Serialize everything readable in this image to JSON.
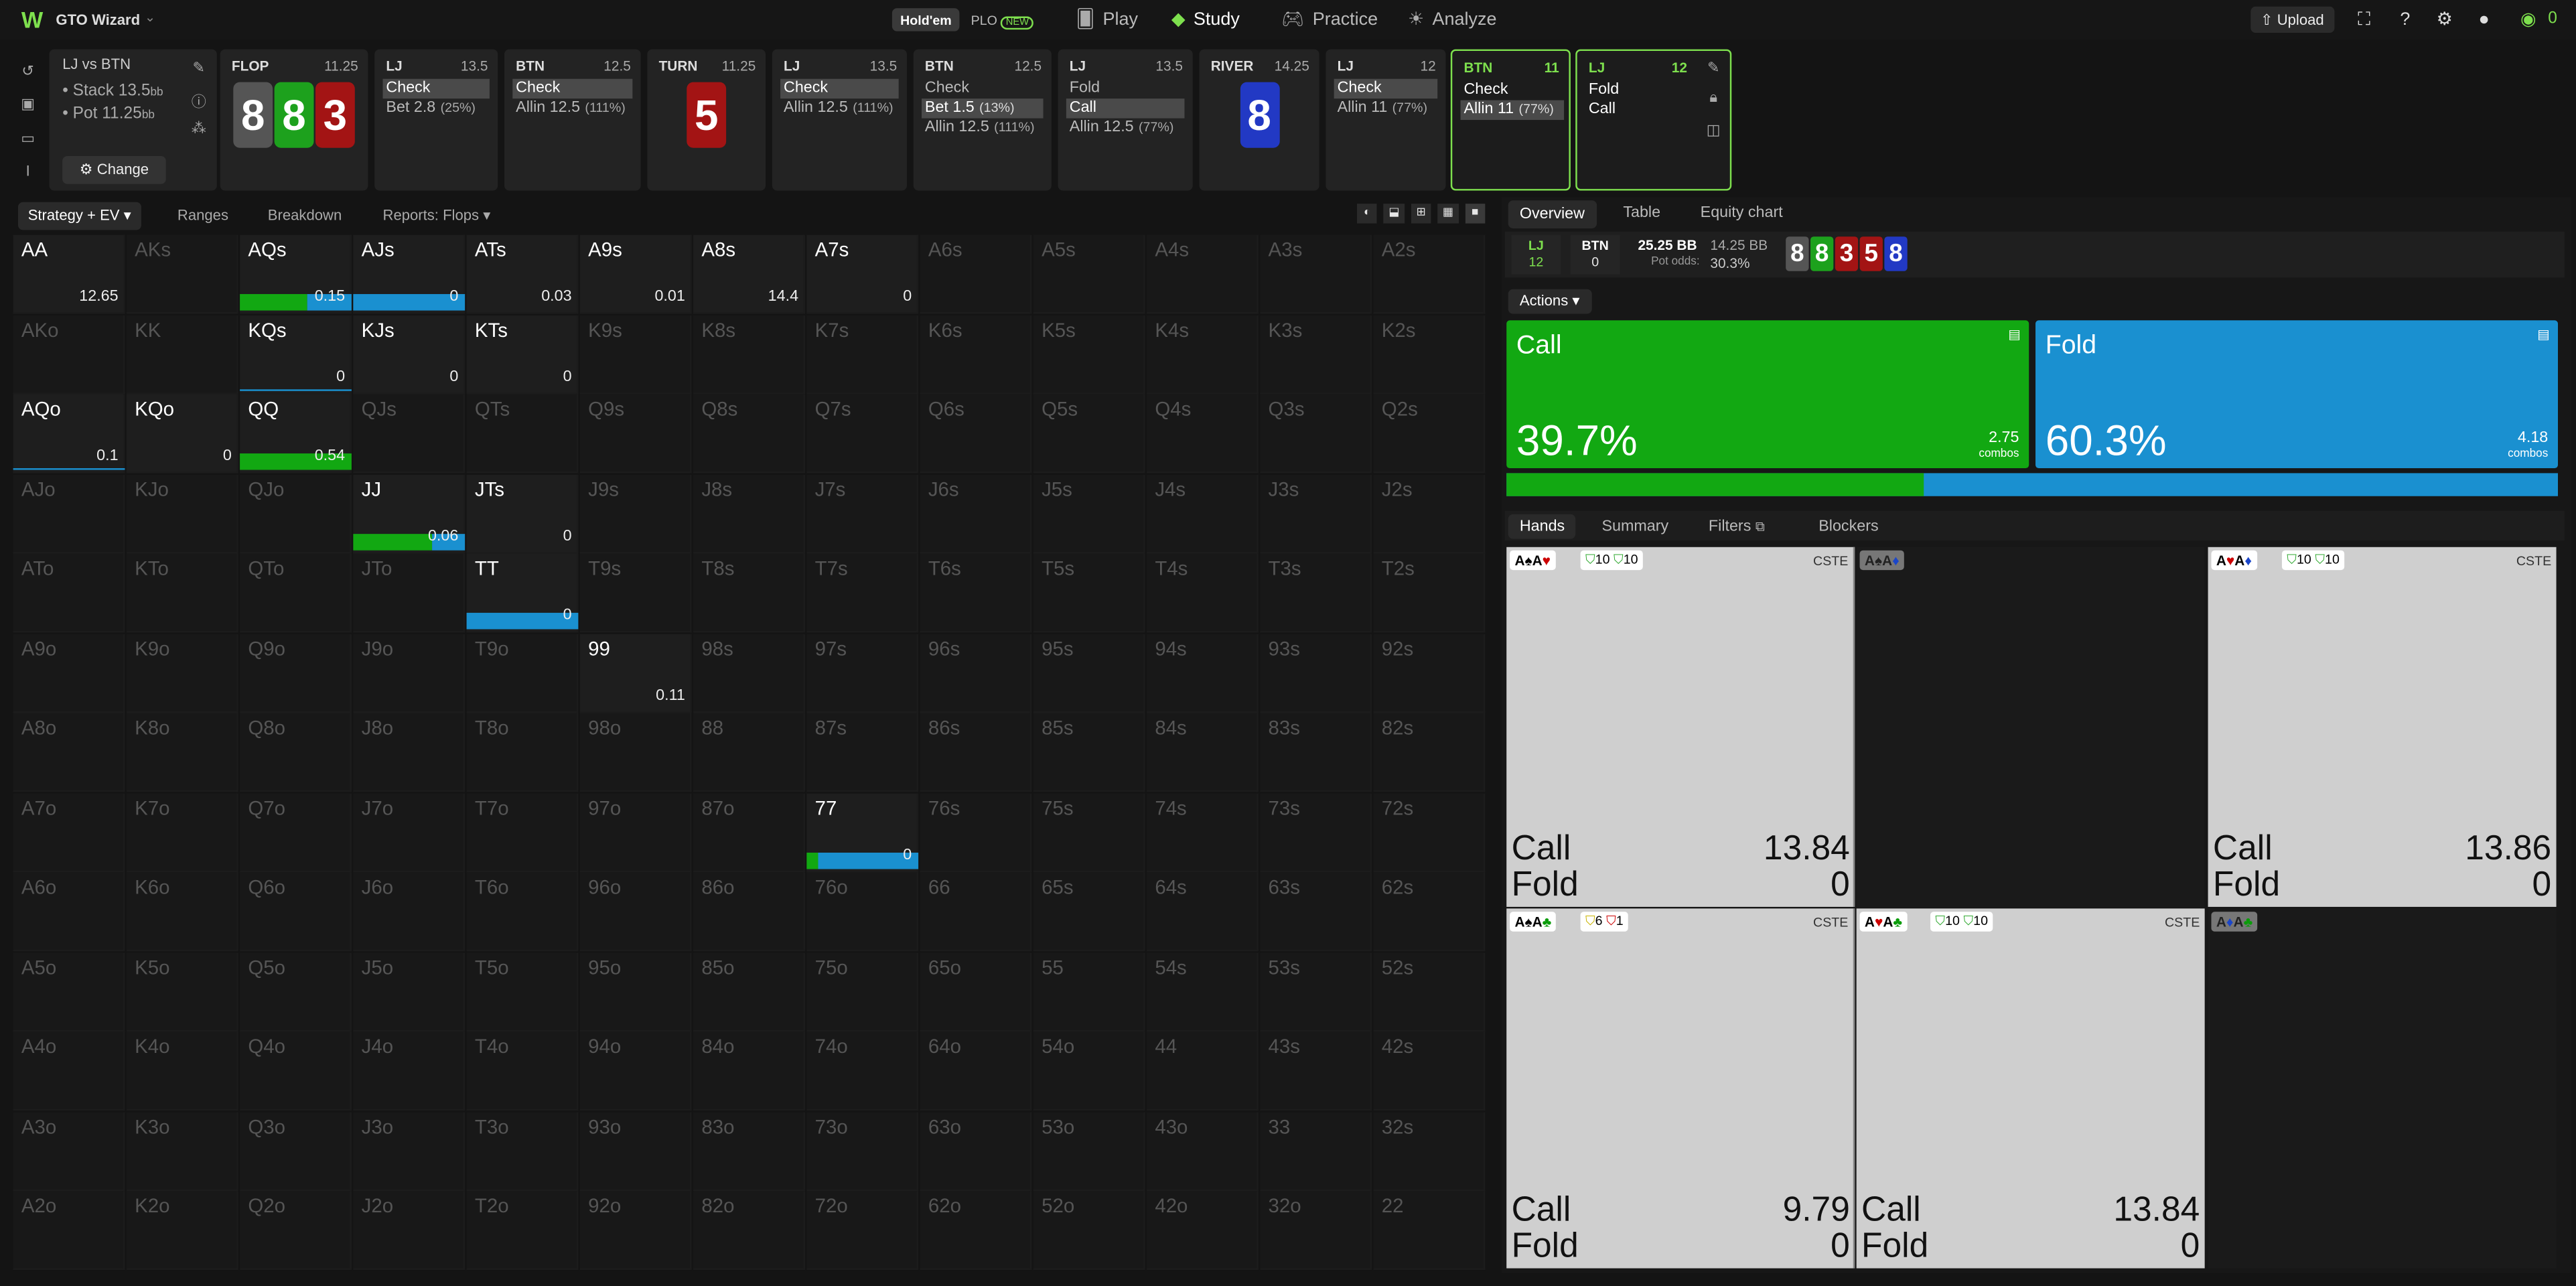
{
  "app": {
    "title": "GTO Wizard",
    "logo": "W"
  },
  "modes": {
    "holdem": "Hold'em",
    "plo": "PLO",
    "plo_badge": "NEW"
  },
  "nav": [
    {
      "label": "Play",
      "icon": "cards-icon"
    },
    {
      "label": "Study",
      "icon": "study-icon"
    },
    {
      "label": "Practice",
      "icon": "gamepad-icon"
    },
    {
      "label": "Analyze",
      "icon": "bulb-icon"
    }
  ],
  "topright": {
    "upload": "Upload",
    "counter": "0"
  },
  "spot": {
    "title": "LJ vs BTN",
    "stack": "• Stack 13.5",
    "stack_unit": "bb",
    "pot": "• Pot 11.25",
    "pot_unit": "bb",
    "change": "Change"
  },
  "panels": [
    {
      "head": "FLOP",
      "val": "11.25"
    },
    {
      "head": "LJ",
      "val": "13.5",
      "opts": [
        {
          "t": "Check",
          "sel": true
        },
        {
          "t": "Bet 2.8",
          "p": "(25%)"
        }
      ]
    },
    {
      "head": "BTN",
      "val": "12.5",
      "opts": [
        {
          "t": "Check",
          "sel": true
        },
        {
          "t": "Allin 12.5",
          "p": "(111%)"
        }
      ]
    },
    {
      "head": "TURN",
      "val": "11.25"
    },
    {
      "head": "LJ",
      "val": "13.5",
      "opts": [
        {
          "t": "Check",
          "sel": true
        },
        {
          "t": "Allin 12.5",
          "p": "(111%)"
        }
      ]
    },
    {
      "head": "BTN",
      "val": "12.5",
      "opts": [
        {
          "t": "Check"
        },
        {
          "t": "Bet 1.5",
          "p": "(13%)",
          "sel": true
        },
        {
          "t": "Allin 12.5",
          "p": "(111%)"
        }
      ]
    },
    {
      "head": "LJ",
      "val": "13.5",
      "opts": [
        {
          "t": "Fold"
        },
        {
          "t": "Call",
          "sel": true
        },
        {
          "t": "Allin 12.5",
          "p": "(77%)"
        }
      ]
    },
    {
      "head": "RIVER",
      "val": "14.25"
    },
    {
      "head": "LJ",
      "val": "12",
      "opts": [
        {
          "t": "Check",
          "sel": true
        },
        {
          "t": "Allin 11",
          "p": "(77%)"
        }
      ]
    },
    {
      "head": "BTN",
      "val": "11",
      "opts": [
        {
          "t": "Check"
        },
        {
          "t": "Allin 11",
          "p": "(77%)",
          "sel": true
        }
      ]
    },
    {
      "head": "LJ",
      "val": "12",
      "opts": [
        {
          "t": "Fold"
        },
        {
          "t": "Call"
        }
      ]
    }
  ],
  "flop_cards": [
    {
      "r": "8",
      "c": "#555"
    },
    {
      "r": "8",
      "c": "#1da11d"
    },
    {
      "r": "3",
      "c": "#a31414"
    }
  ],
  "turn_card": {
    "r": "5",
    "c": "#a31414"
  },
  "river_card": {
    "r": "8",
    "c": "#2239c4"
  },
  "left_tabs": [
    "Strategy + EV",
    "Ranges",
    "Breakdown",
    "Reports: Flops"
  ],
  "grid": {
    "ranks": [
      "A",
      "K",
      "Q",
      "J",
      "T",
      "9",
      "8",
      "7",
      "6",
      "5",
      "4",
      "3",
      "2"
    ],
    "active": {
      "AA": {
        "ev": "12.65"
      },
      "AQs": {
        "ev": "0.15",
        "call": 0.6,
        "fold": 0.4
      },
      "AJs": {
        "ev": "0",
        "call": 0.0,
        "fold": 1.0
      },
      "ATs": {
        "ev": "0.03"
      },
      "A9s": {
        "ev": "0.01"
      },
      "A8s": {
        "ev": "14.4"
      },
      "A7s": {
        "ev": "0"
      },
      "KQs": {
        "ev": "0",
        "fold_line": true
      },
      "KJs": {
        "ev": "0"
      },
      "KTs": {
        "ev": "0"
      },
      "AQo": {
        "ev": "0.1",
        "fold_line": true
      },
      "KQo": {
        "ev": "0"
      },
      "QQ": {
        "ev": "0.54",
        "call": 1.0,
        "fold": 0.0
      },
      "JJ": {
        "ev": "0.06",
        "call": 0.7,
        "fold": 0.3
      },
      "JTs": {
        "ev": "0"
      },
      "TT": {
        "ev": "0",
        "call": 0.0,
        "fold": 1.0
      },
      "99": {
        "ev": "0.11"
      },
      "77": {
        "ev": "0",
        "call": 0.1,
        "fold": 0.9
      }
    }
  },
  "right_tabs": [
    "Overview",
    "Table",
    "Equity chart"
  ],
  "summary": {
    "lj_label": "LJ",
    "lj_val": "12",
    "btn_label": "BTN",
    "btn_val": "0",
    "pot_bb": "25.25 BB",
    "call_bb": "14.25 BB",
    "pot_odds_label": "Pot odds:",
    "pot_odds": "30.3%"
  },
  "board": [
    {
      "r": "8",
      "c": "#555"
    },
    {
      "r": "8",
      "c": "#1da11d"
    },
    {
      "r": "3",
      "c": "#a31414"
    },
    {
      "r": "5",
      "c": "#a31414"
    },
    {
      "r": "8",
      "c": "#2239c4"
    }
  ],
  "actions_btn": "Actions",
  "actions": [
    {
      "name": "Call",
      "pct": "39.7%",
      "combos": "2.75",
      "combos_label": "combos",
      "color": "#12a812",
      "share": 0.397
    },
    {
      "name": "Fold",
      "pct": "60.3%",
      "combos": "4.18",
      "combos_label": "combos",
      "color": "#1a90d0",
      "share": 0.603
    }
  ],
  "bottom_tabs": [
    "Hands",
    "Summary",
    "Filters",
    "Blockers"
  ],
  "hands": [
    {
      "combo": "A♠A♥",
      "b1": "10",
      "b2": "10",
      "cs": "CSTE",
      "call": "13.84",
      "fold": "0",
      "empty": false
    },
    {
      "combo": "A♠A♦",
      "empty": true
    },
    {
      "combo": "A♥A♦",
      "b1": "10",
      "b2": "10",
      "cs": "CSTE",
      "call": "13.86",
      "fold": "0",
      "empty": false
    },
    {
      "combo": "A♠A♣",
      "b1": "6",
      "b2": "1",
      "cs": "CSTE",
      "call": "9.79",
      "fold": "0",
      "empty": false
    },
    {
      "combo": "A♥A♣",
      "b1": "10",
      "b2": "10",
      "cs": "CSTE",
      "call": "13.84",
      "fold": "0",
      "empty": false
    },
    {
      "combo": "A♦A♣",
      "empty": true
    }
  ],
  "labels": {
    "call": "Call",
    "fold": "Fold"
  }
}
